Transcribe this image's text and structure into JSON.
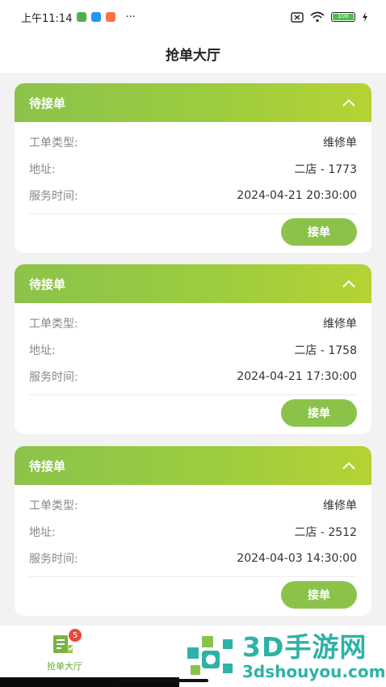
{
  "status_bar": {
    "time": "上午11:14",
    "more": "···",
    "battery": "100"
  },
  "header": {
    "title": "抢单大厅"
  },
  "orders": [
    {
      "status": "待接单",
      "type_label": "工单类型:",
      "type_value": "维修单",
      "address_label": "地址:",
      "address_value": "二店 - 1773",
      "time_label": "服务时间:",
      "time_value": "2024-04-21 20:30:00",
      "accept_label": "接单"
    },
    {
      "status": "待接单",
      "type_label": "工单类型:",
      "type_value": "维修单",
      "address_label": "地址:",
      "address_value": "二店 - 1758",
      "time_label": "服务时间:",
      "time_value": "2024-04-21 17:30:00",
      "accept_label": "接单"
    },
    {
      "status": "待接单",
      "type_label": "工单类型:",
      "type_value": "维修单",
      "address_label": "地址:",
      "address_value": "二店 - 2512",
      "time_label": "服务时间:",
      "time_value": "2024-04-03 14:30:00",
      "accept_label": "接单"
    }
  ],
  "tab_bar": {
    "tab_label": "抢单大厅",
    "badge": "5"
  },
  "watermark": {
    "main": "3D手游网",
    "sub": "3dshouyou.com"
  },
  "colors": {
    "accent": "#8bc34a",
    "accent_end": "#b5d334",
    "badge": "#e84a3a",
    "watermark": "#2db3a6"
  }
}
